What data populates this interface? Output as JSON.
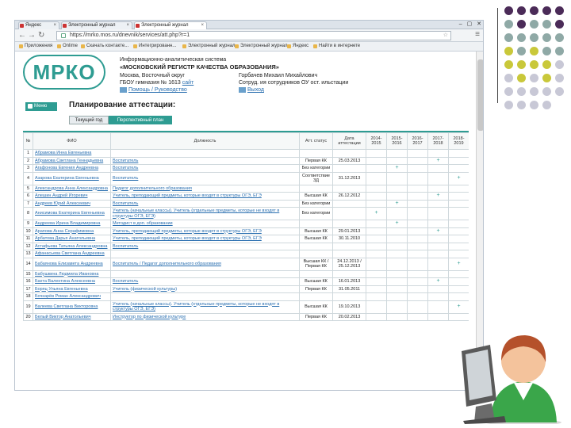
{
  "browser": {
    "tabs": [
      {
        "label": "Яндекс"
      },
      {
        "label": "Электронный журнал"
      },
      {
        "label": "Электронный журнал"
      }
    ],
    "window_controls": "– ▢ ✕",
    "url": "https://mrko.mos.ru/dnevnik/services/att.php?r=1",
    "bookmarks": [
      "Приложения",
      "Onlime",
      "Скачать контакте...",
      "Интегрированн...",
      "Электронный журнал",
      "Электронный журнал",
      "Яндекс",
      "Найти в интернете"
    ]
  },
  "header": {
    "logo": "МРКО",
    "system_line1": "Информационно-аналитическая система",
    "system_line2": "«МОСКОВСКИЙ РЕГИСТР КАЧЕСТВА ОБРАЗОВАНИЯ»",
    "org_line1": "Москва, Восточный округ",
    "org_line2": "ГБОУ гимназия № 1613",
    "site_link": "сайт",
    "user_name": "Горбачев Михаил Михайлович",
    "user_role": "Сотруд. ия сотрудников ОУ ост. ильстации",
    "guide_link": "Помощь / Руководство",
    "exit_link": "Выход"
  },
  "nav": {
    "menu_label": "Меню",
    "page_title": "Планирование аттестации:",
    "segments": [
      "Текущий год",
      "Перспективный план"
    ]
  },
  "table": {
    "headers": [
      "№",
      "ФИО",
      "Должность",
      "Атт. статус",
      "Дата аттестации",
      "2014-2015",
      "2015-2016",
      "2016-2017",
      "2017-2018",
      "2018-2019"
    ],
    "rows": [
      {
        "n": "1",
        "fio": "Абрамова Инна Евгеньевна",
        "pos": "",
        "status": "",
        "date": "",
        "marks": [
          "",
          "",
          "",
          "",
          ""
        ]
      },
      {
        "n": "2",
        "fio": "Абрамова Светлана Геннадьевна",
        "pos": "Воспитатель",
        "status": "Первая КК",
        "date": "25.03.2013",
        "marks": [
          "",
          "",
          "",
          "+",
          ""
        ]
      },
      {
        "n": "3",
        "fio": "Агафонова Евгения Андреевна",
        "pos": "Воспитатель",
        "status": "Без категории",
        "date": "",
        "marks": [
          "",
          "+",
          "",
          "",
          ""
        ]
      },
      {
        "n": "4",
        "fio": "Азарова Екатерина Евгеньевна",
        "pos": "Воспитатель",
        "status": "Соответствие ЗД",
        "date": "31.12.2013",
        "marks": [
          "",
          "",
          "",
          "",
          "+"
        ]
      },
      {
        "n": "5",
        "fio": "Александрова Анна Александровна",
        "pos": "Педагог дополнительного образования",
        "status": "",
        "date": "",
        "marks": [
          "",
          "",
          "",
          "",
          ""
        ]
      },
      {
        "n": "6",
        "fio": "Алешин Андрей Игоревич",
        "pos": "Учитель, преподающий предметы, которые входят в структуры ОГЭ, ЕГЭ",
        "status": "Высшая КК",
        "date": "26.12.2012",
        "marks": [
          "",
          "",
          "",
          "+",
          ""
        ]
      },
      {
        "n": "7",
        "fio": "Андреев Юрий Алексеевич",
        "pos": "Воспитатель",
        "status": "Без категории",
        "date": "",
        "marks": [
          "",
          "+",
          "",
          "",
          ""
        ]
      },
      {
        "n": "8",
        "fio": "Анисимова Екатерина Евгеньевна",
        "pos": "Учитель (начальные классы). Учитель (отдельные предметы, которые не входят в структуры ОГЭ, ЕГЭ)",
        "status": "Без категории",
        "date": "",
        "marks": [
          "+",
          "",
          "",
          "",
          ""
        ]
      },
      {
        "n": "9",
        "fio": "Андреева Ирина Владимировна",
        "pos": "Методист в доп. образовании",
        "status": "",
        "date": "",
        "marks": [
          "",
          "+",
          "",
          "",
          ""
        ]
      },
      {
        "n": "10",
        "fio": "Арапова Анна Серафимовна",
        "pos": "Учитель, преподающий предметы, которые входят в структуры ОГЭ, ЕГЭ",
        "status": "Высшая КК",
        "date": "29.01.2013",
        "marks": [
          "",
          "",
          "",
          "+",
          ""
        ]
      },
      {
        "n": "11",
        "fio": "Арбатова Дарья Анатольевна",
        "pos": "Учитель, преподающий предметы, которые входят в структуры ОГЭ, ЕГЭ",
        "status": "Высшая КК",
        "date": "30.11.2010",
        "marks": [
          "",
          "",
          "",
          "",
          ""
        ]
      },
      {
        "n": "12",
        "fio": "Астафьева Татьяна Александровна",
        "pos": "Воспитатель",
        "status": "",
        "date": "",
        "marks": [
          "",
          "",
          "",
          "",
          ""
        ]
      },
      {
        "n": "13",
        "fio": "Афанасьева Светлана Андреевна",
        "pos": "",
        "status": "",
        "date": "",
        "marks": [
          "",
          "",
          "",
          "",
          ""
        ]
      },
      {
        "n": "14",
        "fio": "Бабаянова Елизавета Андреевна",
        "pos": "Воспитатель / Педагог дополнительного образования",
        "status": "Высшая КК / Первая КК",
        "date": "24.12.2013 / 25.12.2013",
        "marks": [
          "",
          "",
          "",
          "",
          "+"
        ]
      },
      {
        "n": "15",
        "fio": "Бабушкина Людмила Ивановна",
        "pos": "",
        "status": "",
        "date": "",
        "marks": [
          "",
          "",
          "",
          "",
          ""
        ]
      },
      {
        "n": "16",
        "fio": "Бахта Валентина Алексеевна",
        "pos": "Воспитатель",
        "status": "Высшая КК",
        "date": "16.01.2013",
        "marks": [
          "",
          "",
          "",
          "+",
          ""
        ]
      },
      {
        "n": "17",
        "fio": "Боряц Ульяна Евгеньевна",
        "pos": "Учитель (физической культуры)",
        "status": "Первая КК",
        "date": "31.05.2011",
        "marks": [
          "",
          "",
          "",
          "",
          ""
        ]
      },
      {
        "n": "18",
        "fio": "Бочкарёв Роман Александрович",
        "pos": "",
        "status": "",
        "date": "",
        "marks": [
          "",
          "",
          "",
          "",
          ""
        ]
      },
      {
        "n": "19",
        "fio": "Валеева Светлана Викторовна",
        "pos": "Учитель (начальные классы). Учитель (отдельные предметы, которые не входят в структуры ОГЭ, ЕГЭ)",
        "status": "Высшая КК",
        "date": "19.10.2013",
        "marks": [
          "",
          "",
          "",
          "",
          "+"
        ]
      },
      {
        "n": "20",
        "fio": "Белый Виктор Анатольевич",
        "pos": "Инструктор по физической культуре",
        "status": "Первая КК",
        "date": "20.02.2013",
        "marks": [
          "",
          "",
          "",
          "",
          ""
        ]
      }
    ]
  },
  "colors": {
    "accent": "#2e9c92",
    "link": "#2a6fb0",
    "dot_purple": "#4b2b58",
    "dot_teal": "#8fa9a6",
    "dot_olive": "#c9c83a",
    "dot_gray": "#c8c8d6"
  }
}
